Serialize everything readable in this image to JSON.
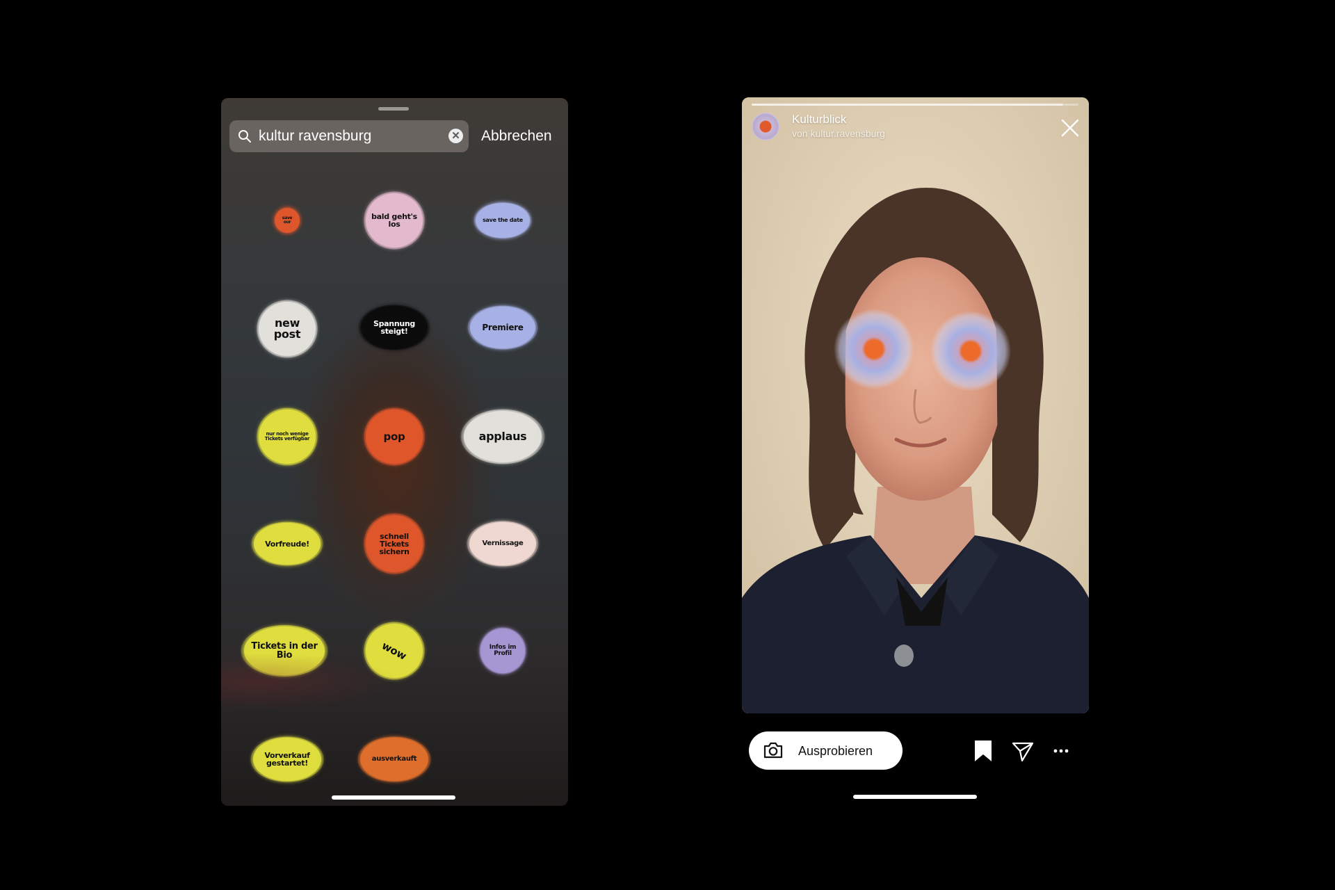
{
  "sticker_panel": {
    "search": {
      "value": "kultur ravensburg"
    },
    "cancel_label": "Abbrechen",
    "stickers": [
      {
        "id": "orange-small",
        "text": "save our",
        "color": "#e2572c",
        "text_color": "#111"
      },
      {
        "id": "bald",
        "text": "bald geht's los",
        "color": "#e7bcd0",
        "text_color": "#111"
      },
      {
        "id": "save-date",
        "text": "save the date",
        "color": "#aab4ea",
        "text_color": "#111"
      },
      {
        "id": "new-post",
        "text": "new post",
        "color": "#e6e4de",
        "text_color": "#111"
      },
      {
        "id": "spannung",
        "text": "Spannung steigt!",
        "color": "#0b0b0b",
        "text_color": "#fff"
      },
      {
        "id": "premiere",
        "text": "Premiere",
        "color": "#aab4ea",
        "text_color": "#111"
      },
      {
        "id": "tickets-few",
        "text": "nur noch wenige Tickets verfügbar",
        "color": "#e3e23f",
        "text_color": "#111"
      },
      {
        "id": "pop",
        "text": "pop",
        "color": "#e2572c",
        "text_color": "#111"
      },
      {
        "id": "applaus",
        "text": "applaus",
        "color": "#e6e4de",
        "text_color": "#111"
      },
      {
        "id": "vorfreude",
        "text": "Vorfreude!",
        "color": "#e3e23f",
        "text_color": "#111"
      },
      {
        "id": "schnell",
        "text": "schnell Tickets sichern",
        "color": "#e2572c",
        "text_color": "#111"
      },
      {
        "id": "vernissage",
        "text": "Vernissage",
        "color": "#f3dcd4",
        "text_color": "#111"
      },
      {
        "id": "tickets-bio",
        "text": "Tickets in der Bio",
        "color": "#e3e23f",
        "text_color": "#111"
      },
      {
        "id": "wow",
        "text": "wow",
        "color": "#e3e23f",
        "text_color": "#111"
      },
      {
        "id": "infos",
        "text": "Infos im Profil",
        "color": "#a998d6",
        "text_color": "#111"
      },
      {
        "id": "vorverkauf",
        "text": "Vorverkauf gestartet!",
        "color": "#e3e23f",
        "text_color": "#111"
      },
      {
        "id": "ausverkauft",
        "text": "ausverkauft",
        "color": "#e2702c",
        "text_color": "#111"
      }
    ]
  },
  "story": {
    "title": "Kulturblick",
    "subtitle": "von kultur.ravensburg",
    "effect_colors": {
      "outer": "#a7b0e3",
      "inner": "#ec6a2a"
    },
    "try_button_label": "Ausprobieren",
    "actions": [
      "bookmark-icon",
      "send-icon",
      "more-icon"
    ]
  }
}
